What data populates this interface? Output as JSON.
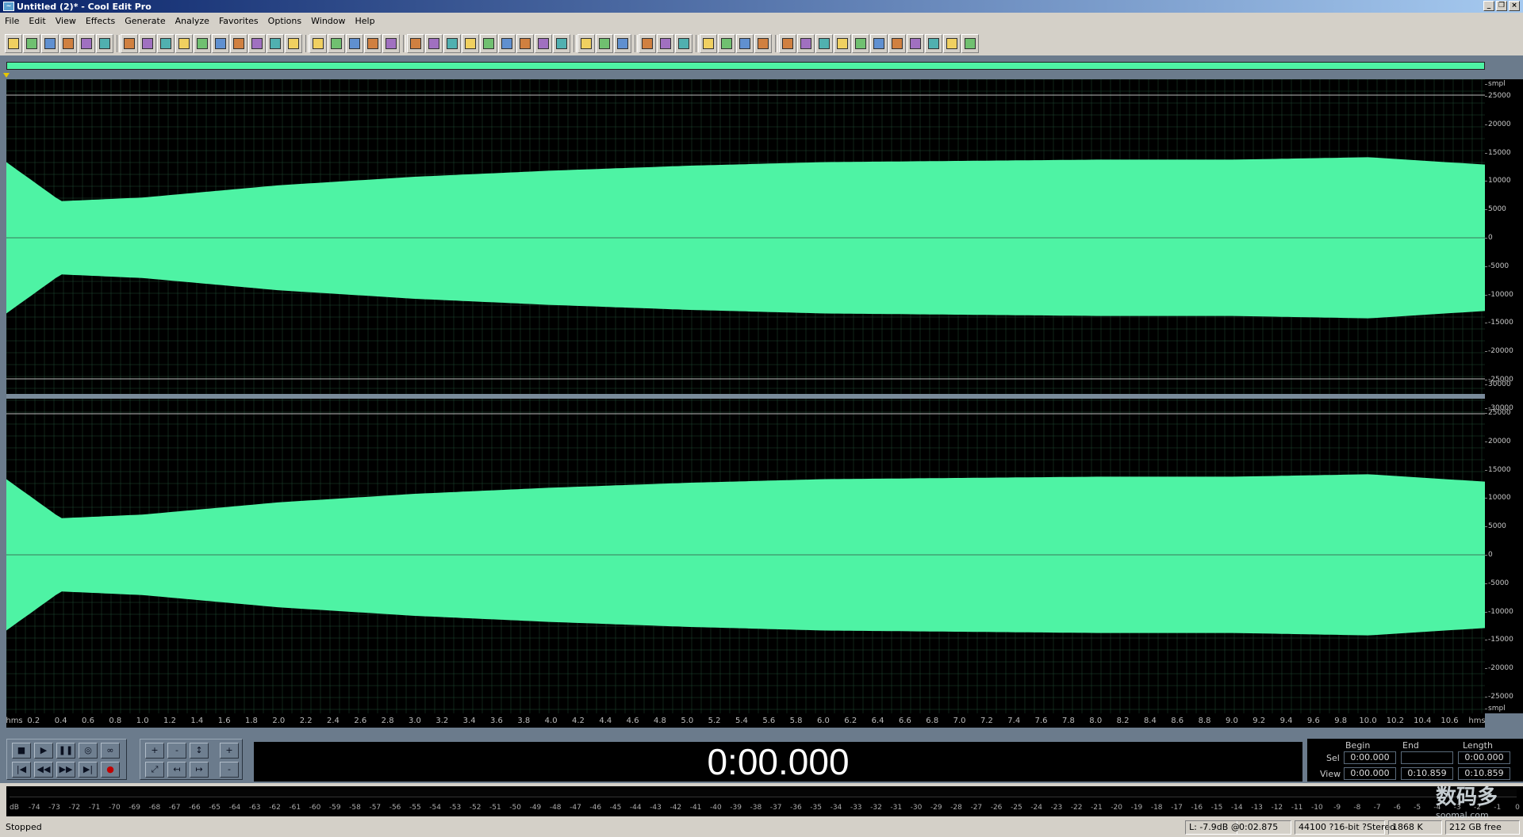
{
  "window": {
    "title": "Untitled (2)* - Cool Edit Pro",
    "app_icon": "cool-edit-icon",
    "controls": [
      "_",
      "❐",
      "×"
    ]
  },
  "menu": [
    "File",
    "Edit",
    "View",
    "Effects",
    "Generate",
    "Analyze",
    "Favorites",
    "Options",
    "Window",
    "Help"
  ],
  "toolbar": {
    "groups": [
      [
        "toggle-view",
        "new",
        "open",
        "save",
        "save-as",
        "close"
      ],
      [
        "undo",
        "redo",
        "cut-special",
        "copy",
        "cut",
        "paste",
        "paste-new",
        "mix-paste",
        "trim",
        "zoom-selection"
      ],
      [
        "envelope",
        "fade",
        "spectral-view",
        "waveform-view",
        "multitrack"
      ],
      [
        "cue-list",
        "play-list",
        "info",
        "play",
        "loop",
        "time-display",
        "snap",
        "metadata",
        "grid"
      ],
      [
        "settings",
        "scripts",
        "help"
      ],
      [
        "frequency-analysis",
        "zoom-to-fit",
        "zoom-reset"
      ],
      [
        "amplify",
        "envelope-fx",
        "normalize",
        "stretch"
      ],
      [
        "noise-reduction",
        "reverse",
        "silence",
        "invert",
        "filter",
        "chorus",
        "delay",
        "distortion",
        "eq",
        "flanger",
        "pitch"
      ]
    ]
  },
  "colors": {
    "waveform": "#4ef3a4",
    "background": "#000000",
    "centerline": "#3a7a5a",
    "grid": "#1e4a32"
  },
  "waveform": {
    "channels": [
      {
        "name": "left",
        "scale_top_label": "smpl",
        "y_ticks": [
          "25000",
          "20000",
          "15000",
          "10000",
          "5000",
          "0",
          "-5000",
          "-10000",
          "-15000",
          "-20000",
          "-25000",
          "-30000"
        ]
      },
      {
        "name": "right",
        "scale_bottom_label": "smpl",
        "y_ticks": [
          "30000",
          "25000",
          "20000",
          "15000",
          "10000",
          "5000",
          "0",
          "-5000",
          "-10000",
          "-15000",
          "-20000",
          "-25000"
        ]
      }
    ],
    "envelope": [
      [
        0,
        0.62
      ],
      [
        0.4,
        0.3
      ],
      [
        1.0,
        0.33
      ],
      [
        2,
        0.43
      ],
      [
        3,
        0.5
      ],
      [
        4,
        0.55
      ],
      [
        5,
        0.59
      ],
      [
        6,
        0.62
      ],
      [
        7,
        0.63
      ],
      [
        8,
        0.64
      ],
      [
        9,
        0.64
      ],
      [
        10,
        0.66
      ],
      [
        10.86,
        0.6
      ]
    ],
    "duration_s": 10.859,
    "x_unit": "hms",
    "x_ticks": [
      "0.2",
      "0.4",
      "0.6",
      "0.8",
      "1.0",
      "1.2",
      "1.4",
      "1.6",
      "1.8",
      "2.0",
      "2.2",
      "2.4",
      "2.6",
      "2.8",
      "3.0",
      "3.2",
      "3.4",
      "3.6",
      "3.8",
      "4.0",
      "4.2",
      "4.4",
      "4.6",
      "4.8",
      "5.0",
      "5.2",
      "5.4",
      "5.6",
      "5.8",
      "6.0",
      "6.2",
      "6.4",
      "6.6",
      "6.8",
      "7.0",
      "7.2",
      "7.4",
      "7.6",
      "7.8",
      "8.0",
      "8.2",
      "8.4",
      "8.6",
      "8.8",
      "9.0",
      "9.2",
      "9.4",
      "9.6",
      "9.8",
      "10.0",
      "10.2",
      "10.4",
      "10.6"
    ]
  },
  "transport": {
    "row1": [
      "■",
      "▶",
      "❚❚",
      "◎",
      "∞"
    ],
    "row2": [
      "|◀",
      "◀◀",
      "▶▶",
      "▶|",
      "●"
    ],
    "zoom_row1": [
      "+",
      "-",
      "↕",
      "+"
    ],
    "zoom_row2": [
      "⤢",
      "↤",
      "↦",
      "-"
    ]
  },
  "time_display": "0:00.000",
  "selection": {
    "headers": {
      "begin": "Begin",
      "end": "End",
      "length": "Length"
    },
    "sel": {
      "label": "Sel",
      "begin": "0:00.000",
      "end": "",
      "length": "0:00.000"
    },
    "view": {
      "label": "View",
      "begin": "0:00.000",
      "end": "0:10.859",
      "length": "0:10.859"
    }
  },
  "meter": {
    "ticks": [
      "dB",
      "-74",
      "-73",
      "-72",
      "-71",
      "-70",
      "-69",
      "-68",
      "-67",
      "-66",
      "-65",
      "-64",
      "-63",
      "-62",
      "-61",
      "-60",
      "-59",
      "-58",
      "-57",
      "-56",
      "-55",
      "-54",
      "-53",
      "-52",
      "-51",
      "-50",
      "-49",
      "-48",
      "-47",
      "-46",
      "-45",
      "-44",
      "-43",
      "-42",
      "-41",
      "-40",
      "-39",
      "-38",
      "-37",
      "-36",
      "-35",
      "-34",
      "-33",
      "-32",
      "-31",
      "-30",
      "-29",
      "-28",
      "-27",
      "-26",
      "-25",
      "-24",
      "-23",
      "-22",
      "-21",
      "-20",
      "-19",
      "-18",
      "-17",
      "-16",
      "-15",
      "-14",
      "-13",
      "-12",
      "-11",
      "-10",
      "-9",
      "-8",
      "-7",
      "-6",
      "-5",
      "-4",
      "-3",
      "-2",
      "-1",
      "0"
    ]
  },
  "status": {
    "state": "Stopped",
    "level": "L: -7.9dB @",
    "position": "0:02.875",
    "format": "44100 ?16-bit ?Stereo",
    "filesize": "1868 K",
    "diskfree": "212 GB free"
  },
  "watermark": {
    "text": "数码多",
    "sub": "soomal.com"
  }
}
